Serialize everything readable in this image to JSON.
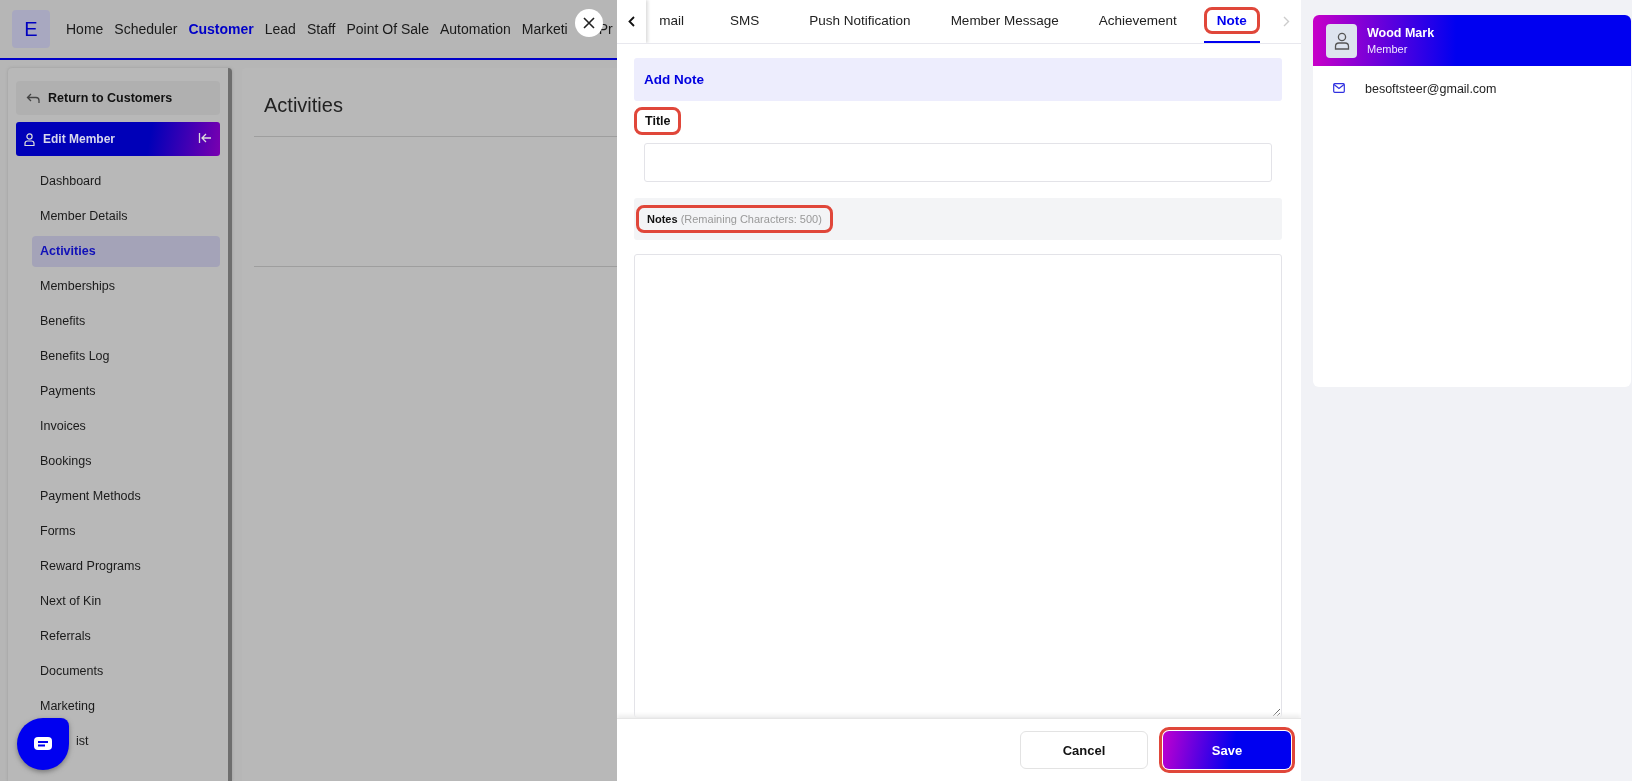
{
  "topnav": {
    "logo": "E",
    "items": [
      {
        "label": "Home",
        "selected": false
      },
      {
        "label": "Scheduler",
        "selected": false
      },
      {
        "label": "Customer",
        "selected": true
      },
      {
        "label": "Lead",
        "selected": false
      },
      {
        "label": "Staff",
        "selected": false
      },
      {
        "label": "Point Of Sale",
        "selected": false
      },
      {
        "label": "Automation",
        "selected": false
      },
      {
        "label": "Marketi",
        "selected": false
      },
      {
        "label": "Pr",
        "selected": false
      }
    ]
  },
  "sidebar": {
    "return_label": "Return to Customers",
    "section": "Edit Member",
    "items": [
      {
        "label": "Dashboard",
        "selected": false
      },
      {
        "label": "Member Details",
        "selected": false
      },
      {
        "label": "Activities",
        "selected": true
      },
      {
        "label": "Memberships",
        "selected": false
      },
      {
        "label": "Benefits",
        "selected": false
      },
      {
        "label": "Benefits Log",
        "selected": false
      },
      {
        "label": "Payments",
        "selected": false
      },
      {
        "label": "Invoices",
        "selected": false
      },
      {
        "label": "Bookings",
        "selected": false
      },
      {
        "label": "Payment Methods",
        "selected": false
      },
      {
        "label": "Forms",
        "selected": false
      },
      {
        "label": "Reward Programs",
        "selected": false
      },
      {
        "label": "Next of Kin",
        "selected": false
      },
      {
        "label": "Referrals",
        "selected": false
      },
      {
        "label": "Documents",
        "selected": false
      },
      {
        "label": "Marketing",
        "selected": false
      },
      {
        "label": "ist",
        "selected": false
      }
    ]
  },
  "main": {
    "title": "Activities"
  },
  "drawer": {
    "tabs": [
      {
        "label": "mail",
        "selected": false,
        "highlighted": false
      },
      {
        "label": "SMS",
        "selected": false,
        "highlighted": false
      },
      {
        "label": "Push Notification",
        "selected": false,
        "highlighted": false
      },
      {
        "label": "Member Message",
        "selected": false,
        "highlighted": false
      },
      {
        "label": "Achievement",
        "selected": false,
        "highlighted": false
      },
      {
        "label": "Note",
        "selected": true,
        "highlighted": true
      }
    ],
    "heading": "Add Note",
    "title_field": {
      "label": "Title",
      "highlighted": true
    },
    "notes_field": {
      "label": "Notes",
      "hint": "(Remaining Characters: 500)",
      "highlighted": true
    },
    "buttons": [
      {
        "label": "Cancel",
        "kind": "secondary",
        "highlighted": false
      },
      {
        "label": "Save",
        "kind": "primary",
        "highlighted": true
      }
    ]
  },
  "profile": {
    "name": "Wood Mark",
    "role": "Member",
    "email": "besoftsteer@gmail.com"
  }
}
